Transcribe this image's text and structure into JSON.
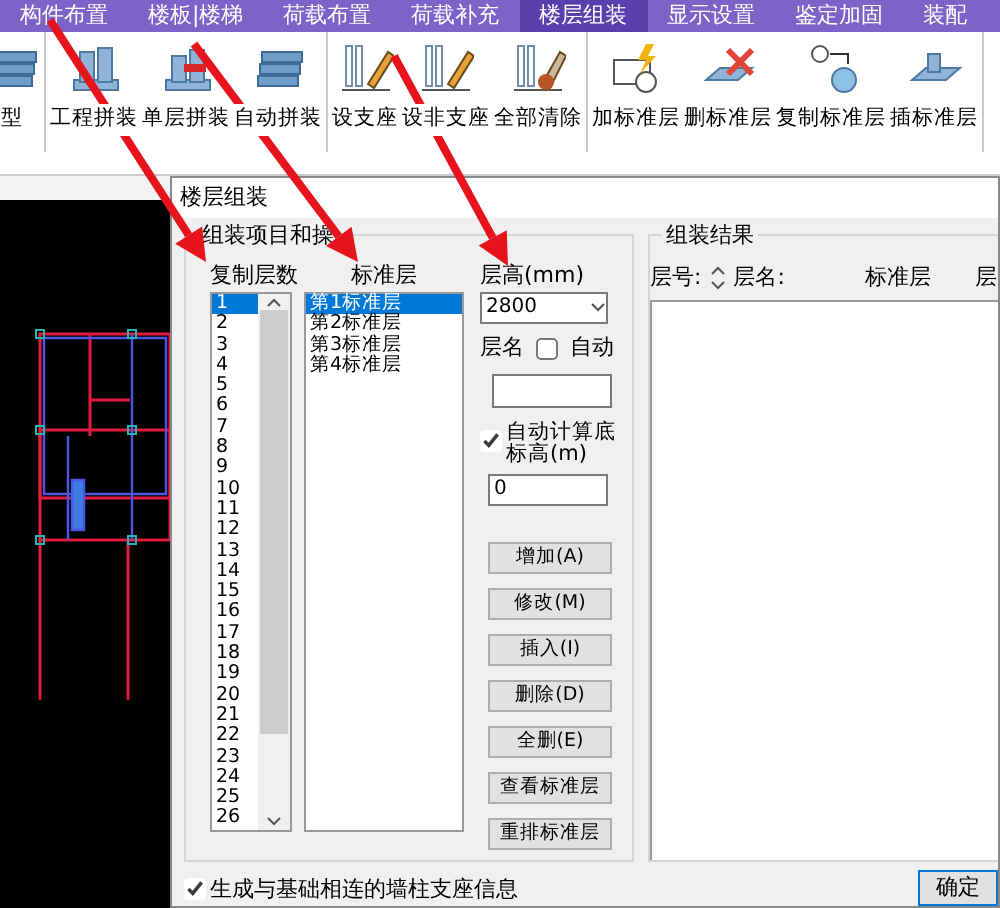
{
  "ribbon_tabs": [
    {
      "label": "构件布置",
      "selected": false
    },
    {
      "label": "楼板|楼梯",
      "selected": false
    },
    {
      "label": "荷载布置",
      "selected": false
    },
    {
      "label": "荷载补充",
      "selected": false
    },
    {
      "label": "楼层组装",
      "selected": true
    },
    {
      "label": "显示设置",
      "selected": false
    },
    {
      "label": "鉴定加固",
      "selected": false
    },
    {
      "label": "装配",
      "selected": false
    }
  ],
  "ribbon_groups": [
    {
      "buttons": [
        {
          "label": "型",
          "kind": "stack"
        }
      ]
    },
    {
      "buttons": [
        {
          "label": "工程拼装",
          "kind": "building"
        },
        {
          "label": "单层拼装",
          "kind": "floor"
        },
        {
          "label": "自动拼装",
          "kind": "stack"
        }
      ]
    },
    {
      "buttons": [
        {
          "label": "设支座",
          "kind": "pencil"
        },
        {
          "label": "设非支座",
          "kind": "pencil"
        },
        {
          "label": "全部清除",
          "kind": "brush"
        }
      ]
    },
    {
      "buttons": [
        {
          "label": "加标准层",
          "kind": "add"
        },
        {
          "label": "删标准层",
          "kind": "delete"
        },
        {
          "label": "复制标准层",
          "kind": "copy"
        },
        {
          "label": "插标准层",
          "kind": "insert"
        }
      ]
    }
  ],
  "dialog": {
    "title": "楼层组装",
    "operations": {
      "title": "组装项目和操",
      "copy_count": {
        "label": "复制层数",
        "items": [
          {
            "label": "1",
            "selected": true
          },
          {
            "label": "2",
            "selected": false
          },
          {
            "label": "3",
            "selected": false
          },
          {
            "label": "4",
            "selected": false
          },
          {
            "label": "5",
            "selected": false
          },
          {
            "label": "6",
            "selected": false
          },
          {
            "label": "7",
            "selected": false
          },
          {
            "label": "8",
            "selected": false
          },
          {
            "label": "9",
            "selected": false
          },
          {
            "label": "10",
            "selected": false
          },
          {
            "label": "11",
            "selected": false
          },
          {
            "label": "12",
            "selected": false
          },
          {
            "label": "13",
            "selected": false
          },
          {
            "label": "14",
            "selected": false
          },
          {
            "label": "15",
            "selected": false
          },
          {
            "label": "16",
            "selected": false
          },
          {
            "label": "17",
            "selected": false
          },
          {
            "label": "18",
            "selected": false
          },
          {
            "label": "19",
            "selected": false
          },
          {
            "label": "20",
            "selected": false
          },
          {
            "label": "21",
            "selected": false
          },
          {
            "label": "22",
            "selected": false
          },
          {
            "label": "23",
            "selected": false
          },
          {
            "label": "24",
            "selected": false
          },
          {
            "label": "25",
            "selected": false
          },
          {
            "label": "26",
            "selected": false
          }
        ]
      },
      "standard_floors": {
        "label": "标准层",
        "items": [
          {
            "label": "第1标准层",
            "selected": true
          },
          {
            "label": "第2标准层",
            "selected": false
          },
          {
            "label": "第3标准层",
            "selected": false
          },
          {
            "label": "第4标准层",
            "selected": false
          }
        ]
      },
      "floor_height": {
        "label": "层高(mm)",
        "value": "2800"
      },
      "floor_name": {
        "label": "层名",
        "auto": {
          "label": "自动",
          "checked": false
        }
      },
      "auto_elevation": {
        "label": "自动计算底标高(m)",
        "checked": true,
        "value": "0"
      },
      "buttons": [
        "增加(A)",
        "修改(M)",
        "插入(I)",
        "删除(D)",
        "全删(E)",
        "查看标准层",
        "重排标准层"
      ]
    },
    "result": {
      "title": "组装结果",
      "columns": [
        "层号:",
        "层名:",
        "标准层",
        "层"
      ]
    },
    "foundation_option": {
      "label": "生成与基础相连的墙柱支座信息",
      "checked": true
    },
    "buttons": [
      "确定"
    ]
  }
}
